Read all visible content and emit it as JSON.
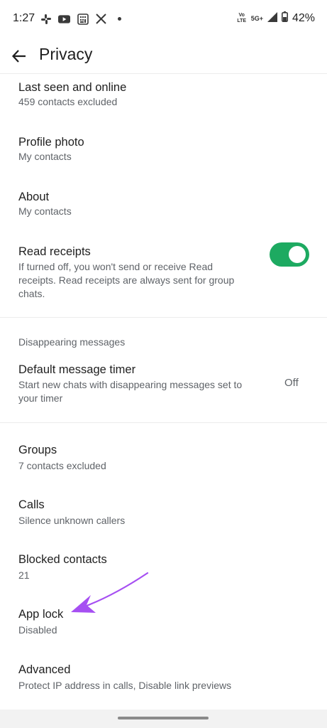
{
  "status_bar": {
    "time": "1:27",
    "left_icons": [
      "slack-icon",
      "youtube-icon",
      "calculator-icon",
      "x-icon",
      "dot-icon"
    ],
    "volte_label": "Vo LTE",
    "network_label": "5G+",
    "battery_percent": "42%"
  },
  "header": {
    "title": "Privacy"
  },
  "items": {
    "last_seen": {
      "title": "Last seen and online",
      "subtitle": "459 contacts excluded"
    },
    "profile_photo": {
      "title": "Profile photo",
      "subtitle": "My contacts"
    },
    "about": {
      "title": "About",
      "subtitle": "My contacts"
    },
    "read_receipts": {
      "title": "Read receipts",
      "subtitle_line1": "If turned off, you won't send or receive Read",
      "subtitle_line2": "receipts. Read receipts are always sent for group",
      "subtitle_line3": "chats.",
      "enabled": true
    },
    "disappearing_header": "Disappearing messages",
    "default_timer": {
      "title": "Default message timer",
      "subtitle_line1": "Start new chats with disappearing messages set to",
      "subtitle_line2": "your timer",
      "value": "Off"
    },
    "groups": {
      "title": "Groups",
      "subtitle": "7 contacts excluded"
    },
    "calls": {
      "title": "Calls",
      "subtitle": "Silence unknown callers"
    },
    "blocked": {
      "title": "Blocked contacts",
      "subtitle": "21"
    },
    "app_lock": {
      "title": "App lock",
      "subtitle": "Disabled"
    },
    "advanced": {
      "title": "Advanced",
      "subtitle": "Protect IP address in calls, Disable link previews"
    }
  },
  "colors": {
    "toggle_on": "#1daa61",
    "annotation_arrow": "#a64ff2"
  }
}
